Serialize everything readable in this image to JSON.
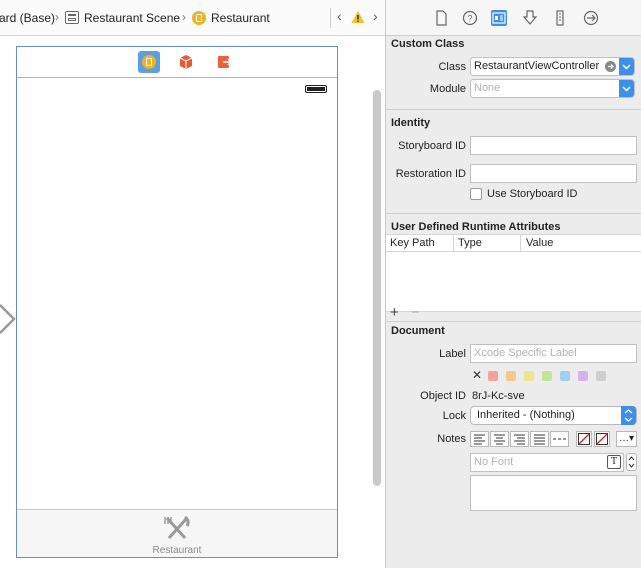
{
  "jumpbar": {
    "crumb_storyboard": "ard (Base)",
    "crumb_scene": "Restaurant Scene",
    "crumb_controller": "Restaurant"
  },
  "scene": {
    "tab_label": "Restaurant"
  },
  "inspector": {
    "custom_class": {
      "title": "Custom Class",
      "class_label": "Class",
      "class_value": "RestaurantViewController",
      "module_label": "Module",
      "module_placeholder": "None"
    },
    "identity": {
      "title": "Identity",
      "storyboard_id_label": "Storyboard ID",
      "restoration_id_label": "Restoration ID",
      "use_storyboard_id_label": "Use Storyboard ID"
    },
    "runtime_attrs": {
      "title": "User Defined Runtime Attributes",
      "columns": [
        "Key Path",
        "Type",
        "Value"
      ]
    },
    "document": {
      "title": "Document",
      "label_label": "Label",
      "label_placeholder": "Xcode Specific Label",
      "object_id_label": "Object ID",
      "object_id_value": "8rJ-Kc-sve",
      "lock_label": "Lock",
      "lock_value": "Inherited - (Nothing)",
      "notes_label": "Notes",
      "font_placeholder": "No Font",
      "swatch_colors": [
        "#f2a49a",
        "#f5c98c",
        "#efe48e",
        "#bfe694",
        "#9fd0f2",
        "#d6b1ec",
        "#cfcfcf"
      ]
    }
  },
  "colors": {
    "accent": "#3d8fe8",
    "scene_border": "#6b8ecb"
  }
}
